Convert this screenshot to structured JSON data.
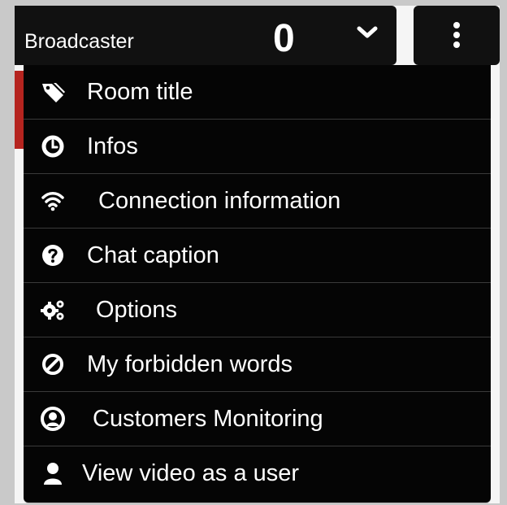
{
  "header": {
    "broadcaster_label": "Broadcaster",
    "viewer_count": "0",
    "dropdown_icon": "chevron-down-icon",
    "menu_icon": "vertical-ellipsis-icon"
  },
  "menu": {
    "items": [
      {
        "label": "Room title",
        "icon": "tag-icon"
      },
      {
        "label": "Infos",
        "icon": "clock-icon"
      },
      {
        "label": "Connection information",
        "icon": "wifi-icon"
      },
      {
        "label": "Chat caption",
        "icon": "question-circle-icon"
      },
      {
        "label": "Options",
        "icon": "gears-icon"
      },
      {
        "label": "My forbidden words",
        "icon": "ban-icon"
      },
      {
        "label": "Customers Monitoring",
        "icon": "user-circle-icon"
      },
      {
        "label": "View video as a user",
        "icon": "user-icon"
      }
    ]
  },
  "colors": {
    "menu_background": "#050505",
    "header_background": "#111111",
    "text": "#ffffff",
    "divider": "#3a3a3a",
    "accent_red": "#b5241f",
    "page_background": "#c9c9c9"
  }
}
